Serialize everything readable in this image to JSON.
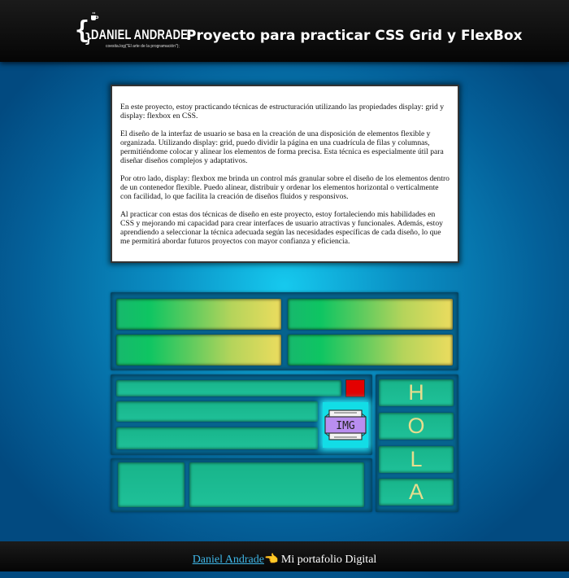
{
  "header": {
    "logo_name": "DANIEL ANDRADE:",
    "logo_tagline": "coesita.log(\"El arte de la programación\");",
    "title": "Proyecto para practicar CSS Grid y FlexBox"
  },
  "intro": {
    "paragraphs": [
      "En este proyecto, estoy practicando técnicas de estructuración utilizando las propiedades display: grid y display: flexbox en CSS.",
      "El diseño de la interfaz de usuario se basa en la creación de una disposición de elementos flexible y organizada. Utilizando display: grid, puedo dividir la página en una cuadrícula de filas y columnas, permitiéndome colocar y alinear los elementos de forma precisa. Esta técnica es especialmente útil para diseñar diseños complejos y adaptativos.",
      "Por otro lado, display: flexbox me brinda un control más granular sobre el diseño de los elementos dentro de un contenedor flexible. Puedo alinear, distribuir y ordenar los elementos horizontal o verticalmente con facilidad, lo que facilita la creación de diseños fluidos y responsivos.",
      "Al practicar con estas dos técnicas de diseño en este proyecto, estoy fortaleciendo mis habilidades en CSS y mejorando mi capacidad para crear interfaces de usuario atractivas y funcionales. Además, estoy aprendiendo a seleccionar la técnica adecuada según las necesidades específicas de cada diseño, lo que me permitirá abordar futuros proyectos con mayor confianza y eficiencia."
    ]
  },
  "demo": {
    "img_label": "IMG",
    "hola_letters": [
      "H",
      "O",
      "L",
      "A"
    ],
    "colors": {
      "accent_red": "#e30000",
      "glow": "#12dde6",
      "letter": "#e6dd8e"
    }
  },
  "footer": {
    "link_text": "Daniel Andrade",
    "emoji": "👈",
    "text": " Mi portafolio Digital"
  }
}
